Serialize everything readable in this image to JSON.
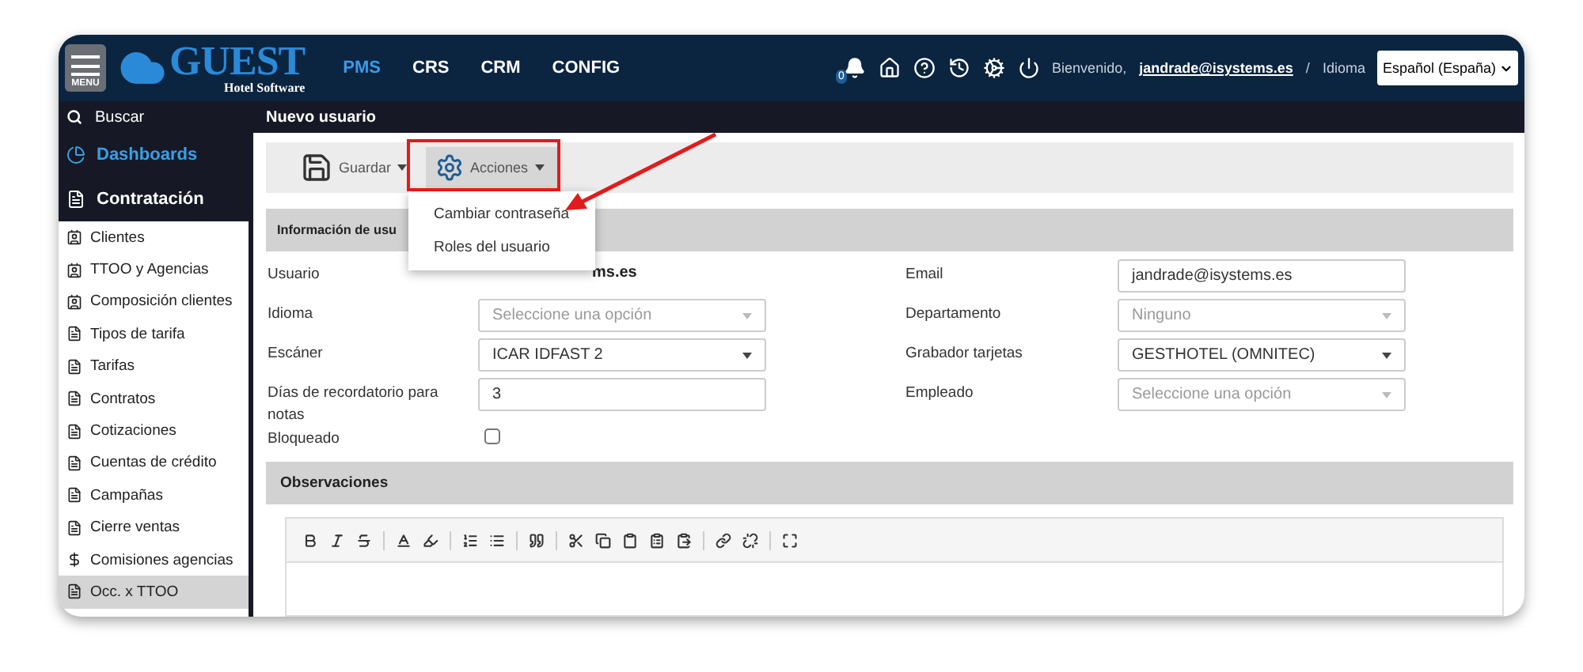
{
  "header": {
    "menu_label": "MENU",
    "logo": {
      "name": "GUEST",
      "subtitle": "Hotel Software"
    },
    "nav": [
      {
        "label": "PMS",
        "selected": true
      },
      {
        "label": "CRS",
        "selected": false
      },
      {
        "label": "CRM",
        "selected": false
      },
      {
        "label": "CONFIG",
        "selected": false
      }
    ],
    "notification_count": "0",
    "welcome": "Bienvenido,",
    "user": "jandrade@isystems.es",
    "separator": "/",
    "language_label": "Idioma",
    "language": "Español (España)"
  },
  "search": {
    "label": "Buscar"
  },
  "page_title": "Nuevo usuario",
  "sidebar": {
    "dashboards": "Dashboards",
    "section": "Contratación",
    "items": [
      {
        "label": "Clientes",
        "kind": "card",
        "selected": false
      },
      {
        "label": "TTOO y Agencias",
        "kind": "card",
        "selected": false
      },
      {
        "label": "Composición clientes",
        "kind": "card",
        "selected": false
      },
      {
        "label": "Tipos de tarifa",
        "kind": "file",
        "selected": false
      },
      {
        "label": "Tarifas",
        "kind": "file",
        "selected": false
      },
      {
        "label": "Contratos",
        "kind": "file",
        "selected": false
      },
      {
        "label": "Cotizaciones",
        "kind": "file",
        "selected": false
      },
      {
        "label": "Cuentas de crédito",
        "kind": "file",
        "selected": false
      },
      {
        "label": "Campañas",
        "kind": "file",
        "selected": false
      },
      {
        "label": "Cierre ventas",
        "kind": "file",
        "selected": false
      },
      {
        "label": "Comisiones agencias",
        "kind": "money",
        "selected": false
      },
      {
        "label": "Occ. x TTOO",
        "kind": "file",
        "selected": true
      }
    ]
  },
  "toolbar": {
    "buttons": [
      {
        "label": "Guardar",
        "selected": false
      },
      {
        "label": "Acciones",
        "selected": true
      }
    ],
    "menu": [
      "Cambiar contraseña",
      "Roles del usuario"
    ]
  },
  "user_section": {
    "title": "Información de usu"
  },
  "form": {
    "left": [
      {
        "label": "Usuario",
        "kind": "text",
        "value": "ms.es"
      },
      {
        "label": "Idioma",
        "kind": "select",
        "placeholder": "Seleccione una opción"
      },
      {
        "label": "Escáner",
        "kind": "select",
        "value": "ICAR IDFAST 2"
      },
      {
        "label": "Días de recordatorio para notas",
        "kind": "input",
        "value": "3"
      },
      {
        "label": "Bloqueado",
        "kind": "checkbox",
        "checked": false
      }
    ],
    "right": [
      {
        "label": "Email",
        "kind": "input",
        "value": "jandrade@isystems.es"
      },
      {
        "label": "Departamento",
        "kind": "select",
        "placeholder": "Ninguno"
      },
      {
        "label": "Grabador tarjetas",
        "kind": "select",
        "value": "GESTHOTEL (OMNITEC)"
      },
      {
        "label": "Empleado",
        "kind": "select",
        "placeholder": "Seleccione una opción"
      }
    ]
  },
  "notes_section": {
    "title": "Observaciones"
  }
}
